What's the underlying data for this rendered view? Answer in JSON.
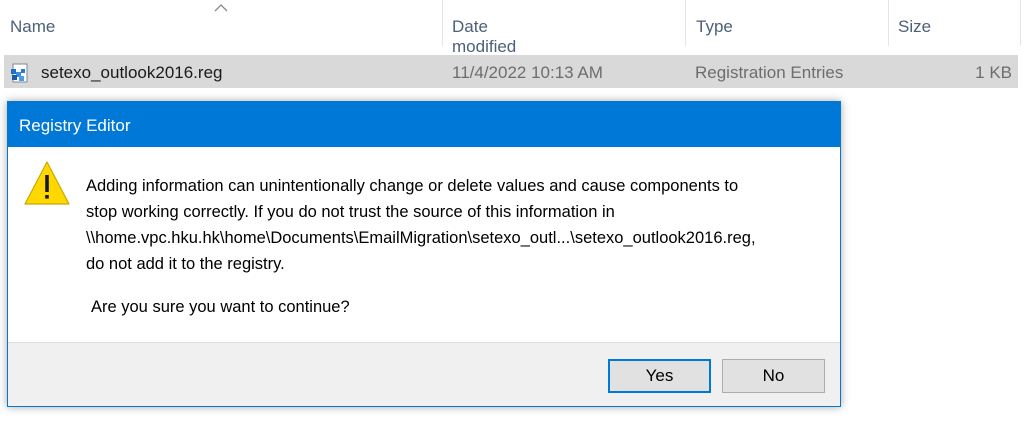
{
  "explorer": {
    "columns": {
      "name": "Name",
      "date_modified": "Date modified",
      "type": "Type",
      "size": "Size"
    },
    "sort_indicator_icon": "chevron-up-icon",
    "file": {
      "name": "setexo_outlook2016.reg",
      "date_modified": "11/4/2022 10:13 AM",
      "type": "Registration Entries",
      "size": "1 KB",
      "icon": "registry-file-icon"
    }
  },
  "dialog": {
    "title": "Registry Editor",
    "icon": "warning-icon",
    "message_lines": [
      "Adding information can unintentionally change or delete values and cause components to",
      "stop working correctly. If you do not trust the source of this information in",
      "\\\\home.vpc.hku.hk\\home\\Documents\\EmailMigration\\setexo_outl...\\setexo_outlook2016.reg,",
      "do not add it to the registry."
    ],
    "question": "Are you sure you want to continue?",
    "buttons": {
      "yes": "Yes",
      "no": "No"
    }
  },
  "colors": {
    "titlebar": "#0078d7",
    "selected_row": "#d9d9d9",
    "footer": "#f0f0f0",
    "warning": "#ffd800"
  }
}
